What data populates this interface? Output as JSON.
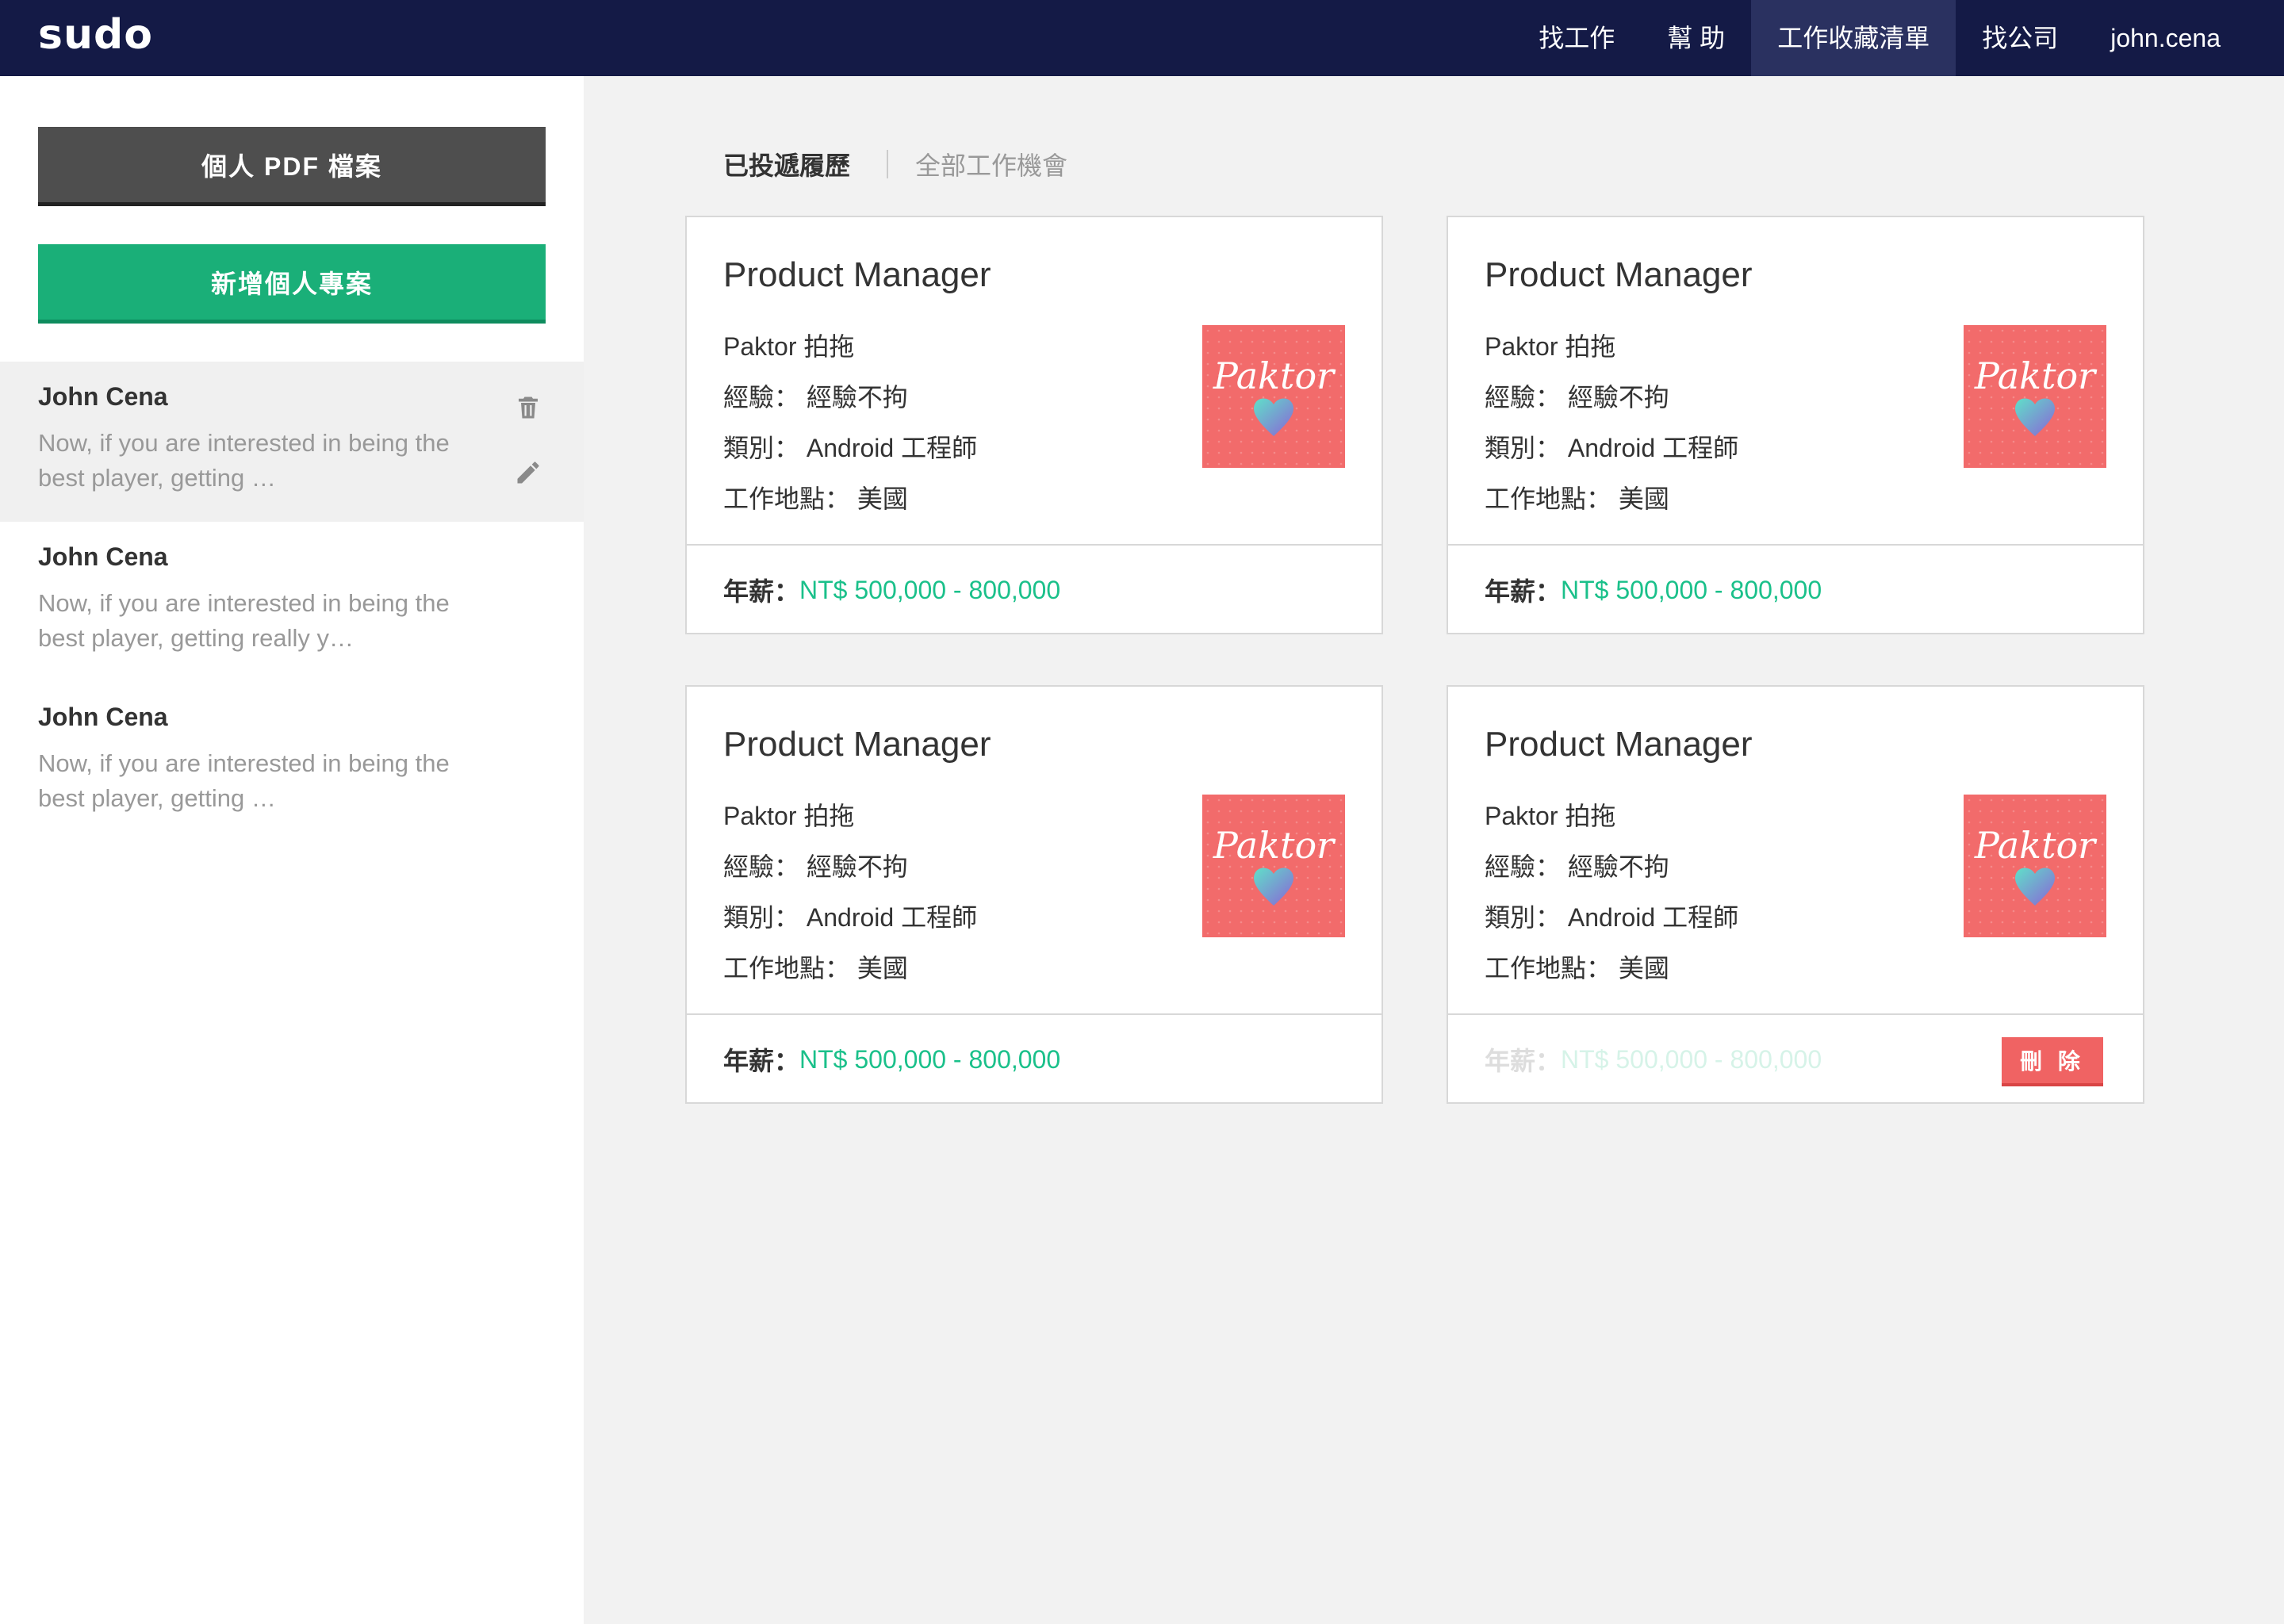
{
  "app": {
    "logo": "sudo"
  },
  "nav": {
    "items": [
      {
        "label": "找工作"
      },
      {
        "label": "幫 助"
      },
      {
        "label": "工作收藏清單",
        "active": true
      },
      {
        "label": "找公司"
      },
      {
        "label": "john.cena"
      }
    ]
  },
  "sidebar": {
    "pdf_button": "個人 PDF 檔案",
    "add_button": "新增個人專案",
    "projects": [
      {
        "name": "John Cena",
        "desc": "Now, if you are interested in being the best player, getting …"
      },
      {
        "name": "John Cena",
        "desc": "Now, if you are interested in being the best player, getting really y…"
      },
      {
        "name": "John Cena",
        "desc": "Now, if you are interested in being the best player, getting …"
      }
    ]
  },
  "tabs": {
    "applied": "已投遞履歷",
    "all": "全部工作機會"
  },
  "cards": [
    {
      "title": "Product Manager",
      "company": "Paktor 拍拖",
      "experience": "經驗： 經驗不拘",
      "category": "類別： Android 工程師",
      "location": "工作地點： 美國",
      "salary_label": "年薪：",
      "salary": "NT$ 500,000 - 800,000",
      "logo_text": "Paktor"
    },
    {
      "title": "Product Manager",
      "company": "Paktor 拍拖",
      "experience": "經驗： 經驗不拘",
      "category": "類別： Android 工程師",
      "location": "工作地點： 美國",
      "salary_label": "年薪：",
      "salary": "NT$ 500,000 - 800,000",
      "logo_text": "Paktor"
    },
    {
      "title": "Product Manager",
      "company": "Paktor 拍拖",
      "experience": "經驗： 經驗不拘",
      "category": "類別： Android 工程師",
      "location": "工作地點： 美國",
      "salary_label": "年薪：",
      "salary": "NT$ 500,000 - 800,000",
      "logo_text": "Paktor"
    },
    {
      "title": "Product Manager",
      "company": "Paktor 拍拖",
      "experience": "經驗： 經驗不拘",
      "category": "類別： Android 工程師",
      "location": "工作地點： 美國",
      "salary_label": "年薪：",
      "salary": "NT$ 500,000 - 800,000",
      "logo_text": "Paktor",
      "delete_label": "刪 除"
    }
  ],
  "colors": {
    "nav_bg": "#141a46",
    "accent_green": "#1aaf78",
    "salary_green": "#1ac08a",
    "delete_red": "#f06363",
    "logo_bg": "#f26b6b"
  },
  "icons": {
    "trash": "trash-icon",
    "pencil": "pencil-icon"
  }
}
